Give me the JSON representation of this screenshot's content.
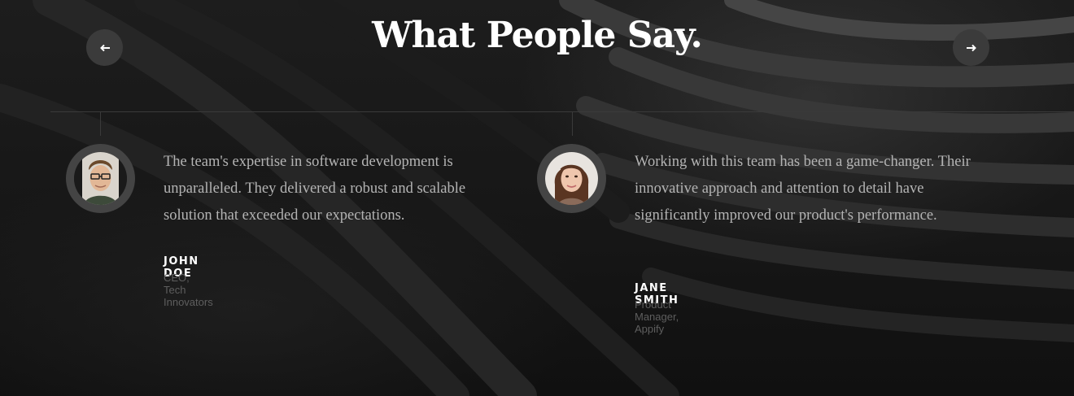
{
  "section": {
    "title": "What People Say."
  },
  "nav": {
    "prev_icon": "arrow-left-icon",
    "next_icon": "arrow-right-icon"
  },
  "testimonials": [
    {
      "quote": "The team's expertise in software development is unparalleled. They delivered a robust and scalable solution that exceeded our expectations.",
      "name": "JOHN DOE",
      "role": "CEO, Tech Innovators"
    },
    {
      "quote": "Working with this team has been a game-changer. Their innovative approach and attention to detail have significantly improved our product's performance.",
      "name": "JANE SMITH",
      "role": "Product Manager, Appify"
    }
  ],
  "colors": {
    "background": "#161616",
    "title": "#ffffff",
    "quote_text": "#b4b4b4",
    "role_text": "#5e5e5e",
    "nav_button": "#3b3b3b"
  }
}
